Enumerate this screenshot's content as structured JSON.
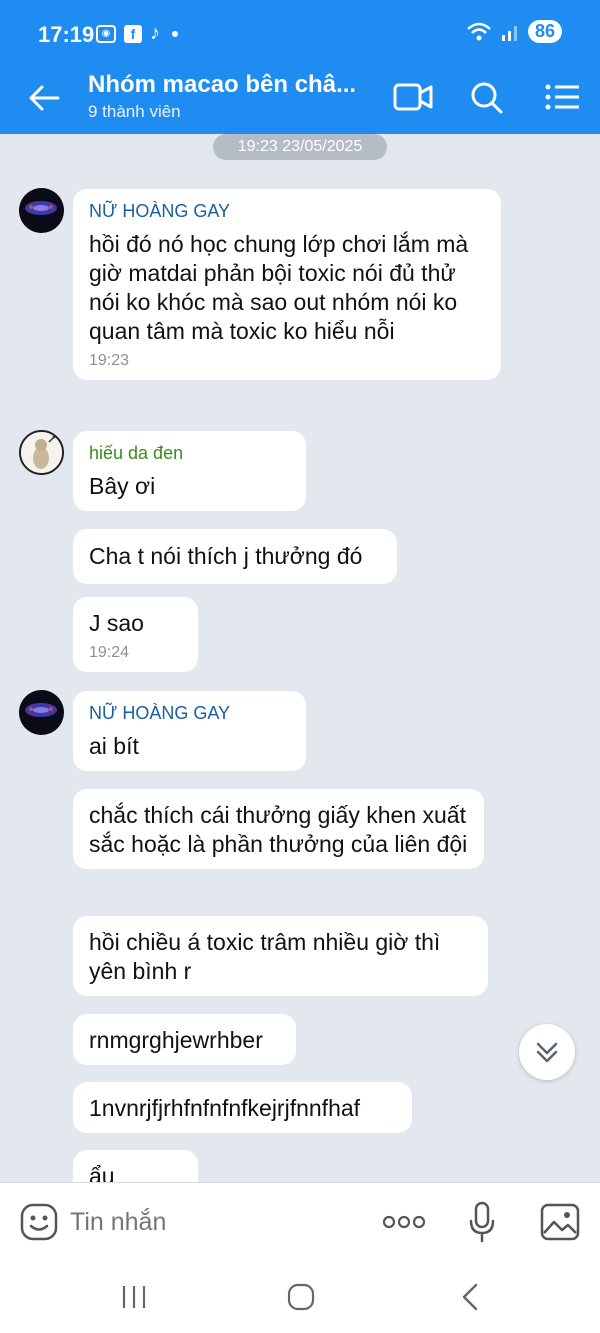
{
  "status": {
    "time": "17:19",
    "battery": "86"
  },
  "header": {
    "title": "Nhóm macao bên châ...",
    "subtitle": "9 thành viên"
  },
  "chat": {
    "date": "19:23 23/05/2025",
    "groups": [
      {
        "sender": "NỮ HOÀNG GAY",
        "messages": [
          {
            "text": "hồi đó nó học chung lớp chơi lắm mà giờ matdai phản bội toxic nói đủ thử nói ko khóc mà sao out nhóm nói ko quan tâm mà toxic ko hiểu nỗi",
            "time": "19:23"
          }
        ]
      },
      {
        "sender": "hiếu da đen",
        "messages": [
          {
            "text": "Bây ơi"
          },
          {
            "text": "Cha t nói thích j thưởng đó"
          },
          {
            "text": "J sao",
            "time": "19:24"
          }
        ]
      },
      {
        "sender": "NỮ HOÀNG GAY",
        "messages": [
          {
            "text": "ai bít"
          },
          {
            "text": "chắc thích cái thưởng giấy khen xuất sắc hoặc là phần thưởng của liên đội"
          },
          {
            "text": "hồi chiều á toxic trâm nhiều giờ thì yên bình r"
          },
          {
            "text": "rnmgrghjewrhber"
          },
          {
            "text": "1nvnrjfjrhfnfnfnfkejrjfnnfhaf"
          },
          {
            "text": "ẩu"
          }
        ]
      }
    ]
  },
  "input": {
    "placeholder": "Tin nhắn"
  },
  "colors": {
    "accent": "#1e8cf0",
    "background": "#e3e8ee",
    "sender_1": "#1a5f9e",
    "sender_2": "#3b8a1f"
  }
}
